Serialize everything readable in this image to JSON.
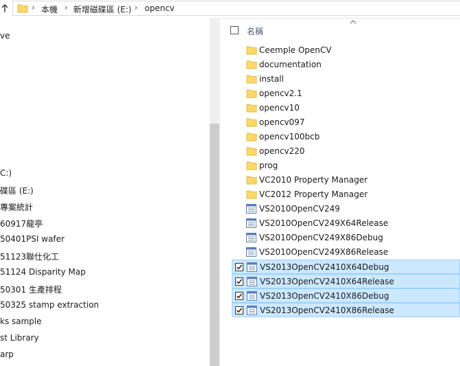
{
  "address_bar": {
    "crumbs": [
      "本機",
      "新增磁碟區 (E:)",
      "opencv"
    ],
    "separator": "›"
  },
  "nav_pane": {
    "items": [
      {
        "label": "ve"
      },
      {
        "label": "C:)"
      },
      {
        "label": "碟區 (E:)"
      },
      {
        "label": "專案統計"
      },
      {
        "label": "60917龍亭"
      },
      {
        "label": "50401PSI wafer"
      },
      {
        "label": "51123聯仕化工"
      },
      {
        "label": "51124 Disparity Map"
      },
      {
        "label": "50301 生產排程"
      },
      {
        "label": "50325 stamp extraction"
      },
      {
        "label": "ks sample"
      },
      {
        "label": "st Library"
      },
      {
        "label": "arp"
      }
    ]
  },
  "file_list": {
    "column_header": "名稱",
    "rows": [
      {
        "name": "Ceemple OpenCV",
        "type": "folder",
        "selected": false
      },
      {
        "name": "documentation",
        "type": "folder",
        "selected": false
      },
      {
        "name": "install",
        "type": "folder",
        "selected": false
      },
      {
        "name": "opencv2.1",
        "type": "folder",
        "selected": false
      },
      {
        "name": "opencv10",
        "type": "folder",
        "selected": false
      },
      {
        "name": "opencv097",
        "type": "folder",
        "selected": false
      },
      {
        "name": "opencv100bcb",
        "type": "folder",
        "selected": false
      },
      {
        "name": "opencv220",
        "type": "folder",
        "selected": false
      },
      {
        "name": "prog",
        "type": "folder",
        "selected": false
      },
      {
        "name": "VC2010 Property Manager",
        "type": "folder",
        "selected": false
      },
      {
        "name": "VC2012 Property Manager",
        "type": "folder",
        "selected": false
      },
      {
        "name": "VS2010OpenCV249",
        "type": "props",
        "selected": false
      },
      {
        "name": "VS2010OpenCV249X64Release",
        "type": "props",
        "selected": false
      },
      {
        "name": "VS2010OpenCV249X86Debug",
        "type": "props",
        "selected": false
      },
      {
        "name": "VS2010OpenCV249X86Release",
        "type": "props",
        "selected": false
      },
      {
        "name": "VS2013OpenCV2410X64Debug",
        "type": "props",
        "selected": true
      },
      {
        "name": "VS2013OpenCV2410X64Release",
        "type": "props",
        "selected": true
      },
      {
        "name": "VS2013OpenCV2410X86Debug",
        "type": "props",
        "selected": true
      },
      {
        "name": "VS2013OpenCV2410X86Release",
        "type": "props",
        "selected": true
      }
    ]
  },
  "colors": {
    "selection_fill": "#cce8ff",
    "selection_border": "#99d1ff",
    "folder_yellow": "#ffd866",
    "scrollbar_thumb": "#cdcdcd"
  }
}
